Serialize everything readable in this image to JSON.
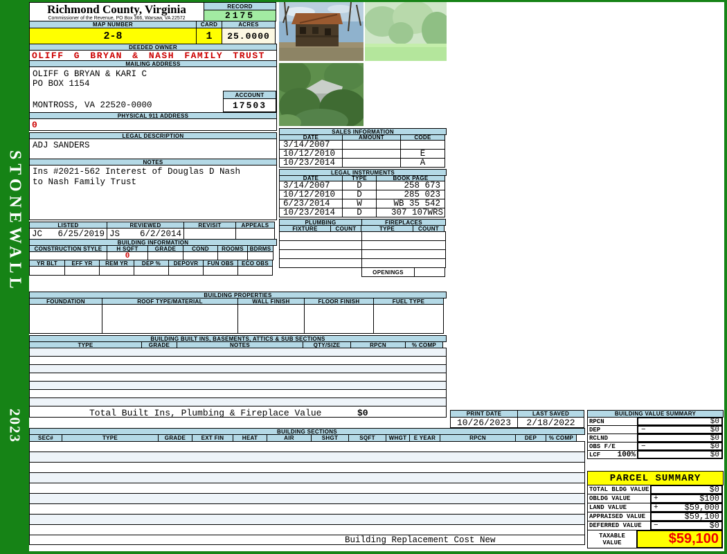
{
  "colors": {
    "green": "#168316",
    "band": "#b4d9e6",
    "yellow": "#ffff00",
    "record_green": "#a2eba2",
    "cream": "#fcf8e3",
    "red": "#cc0000"
  },
  "sidebar": {
    "district": "STONEWALL",
    "year": "2023"
  },
  "header": {
    "county": "Richmond County, Virginia",
    "subtitle": "Commissioner of the Revenue, PO Box 366, Warsaw, VA 22572",
    "record_label": "RECORD",
    "record_value": "2175",
    "map_label": "MAP NUMBER",
    "map_value": "2-8",
    "card_label": "CARD",
    "card_value": "1",
    "acres_label": "ACRES",
    "acres_value": "25.0000"
  },
  "owner": {
    "deeded_label": "DEEDED OWNER",
    "deeded_value": "OLIFF G BRYAN & NASH FAMILY TRUST",
    "mailing_label": "MAILING ADDRESS",
    "mailing_line1": "OLIFF G BRYAN & KARI C",
    "mailing_line2": "PO BOX 1154",
    "mailing_line3": "MONTROSS, VA 22520-0000",
    "account_label": "ACCOUNT",
    "account_value": "17503",
    "physical_label": "PHYSICAL 911 ADDRESS",
    "physical_value": "0"
  },
  "legal": {
    "label": "LEGAL DESCRIPTION",
    "value": "ADJ SANDERS",
    "notes_label": "NOTES",
    "notes_line1": "Ins #2021-562 Interest of Douglas D Nash",
    "notes_line2": "to Nash Family Trust"
  },
  "review": {
    "listed_label": "LISTED",
    "listed_by": "JC",
    "listed_date": "6/25/2019",
    "reviewed_label": "REVIEWED",
    "reviewed_by": "JS",
    "reviewed_date": "6/2/2014",
    "revisit_label": "REVISIT",
    "appeals_label": "APPEALS"
  },
  "building_info": {
    "title": "BUILDING INFORMATION",
    "headers1": [
      "CONSTRUCTION STYLE",
      "H SQFT",
      "GRADE",
      "COND",
      "ROOMS",
      "BDRMS"
    ],
    "h_sqft_value": "0",
    "headers2": [
      "YR BLT",
      "EFF YR",
      "REM YR",
      "DEP %",
      "DEPOVR",
      "FUN OBS",
      "ECO OBS"
    ]
  },
  "building_properties": {
    "title": "BUILDING PROPERTIES",
    "headers": [
      "FOUNDATION",
      "ROOF TYPE/MATERIAL",
      "WALL FINISH",
      "FLOOR FINISH",
      "FUEL TYPE"
    ]
  },
  "built_ins": {
    "title": "BUILDING BUILT INS, BASEMENTS, ATTICS & SUB SECTIONS",
    "headers": [
      "TYPE",
      "GRADE",
      "NOTES",
      "QTY/SIZE",
      "RPCN",
      "% COMP"
    ],
    "total_label": "Total Built Ins, Plumbing & Fireplace Value",
    "total_value": "$0"
  },
  "sales": {
    "title": "SALES INFORMATION",
    "headers": [
      "DATE",
      "AMOUNT",
      "CODE"
    ],
    "rows": [
      {
        "date": "3/14/2007",
        "amount": "",
        "code": ""
      },
      {
        "date": "10/12/2010",
        "amount": "",
        "code": "E"
      },
      {
        "date": "10/23/2014",
        "amount": "",
        "code": "A"
      }
    ]
  },
  "instruments": {
    "title": "LEGAL INSTRUMENTS",
    "headers": [
      "DATE",
      "TYPE",
      "BOOK PAGE"
    ],
    "rows": [
      {
        "date": "3/14/2007",
        "type": "D",
        "book_page": "258 673"
      },
      {
        "date": "10/12/2010",
        "type": "D",
        "book_page": "285 023"
      },
      {
        "date": "6/23/2014",
        "type": "W",
        "book_page": "WB 35 542"
      },
      {
        "date": "10/23/2014",
        "type": "D",
        "book_page": "307 107WRS"
      }
    ]
  },
  "plumbing": {
    "title": "PLUMBING",
    "headers": [
      "FIXTURE",
      "COUNT"
    ]
  },
  "fireplaces": {
    "title": "FIREPLACES",
    "headers": [
      "TYPE",
      "COUNT"
    ],
    "openings_label": "OPENINGS"
  },
  "dates": {
    "print_label": "PRINT DATE",
    "print_value": "10/26/2023",
    "saved_label": "LAST SAVED",
    "saved_value": "2/18/2022"
  },
  "building_value_summary": {
    "title": "BUILDING VALUE SUMMARY",
    "rows": [
      {
        "label": "RPCN",
        "pct": "",
        "sign": "",
        "value": "$0"
      },
      {
        "label": "DEP",
        "pct": "",
        "sign": "−",
        "value": "$0"
      },
      {
        "label": "RCLND",
        "pct": "",
        "sign": "",
        "value": "$0"
      },
      {
        "label": "OBS F/E",
        "pct": "",
        "sign": "−",
        "value": "$0"
      },
      {
        "label": "LCF",
        "pct": "100%",
        "sign": "",
        "value": "$0"
      }
    ]
  },
  "parcel_summary": {
    "title": "PARCEL SUMMARY",
    "rows": [
      {
        "label": "TOTAL BLDG VALUE",
        "sign": "",
        "value": "$0"
      },
      {
        "label": "OBLDG VALUE",
        "sign": "+",
        "value": "$100"
      },
      {
        "label": "LAND VALUE",
        "sign": "+",
        "value": "$59,000"
      },
      {
        "label": "APPRAISED VALUE",
        "sign": "",
        "value": "$59,100"
      },
      {
        "label": "DEFERRED VALUE",
        "sign": "−",
        "value": "$0"
      }
    ],
    "taxable_label": "TAXABLE VALUE",
    "taxable_value": "$59,100"
  },
  "building_sections": {
    "title": "BUILDING SECTIONS",
    "headers": [
      "SEC#",
      "TYPE",
      "GRADE",
      "EXT FIN",
      "HEAT",
      "AIR",
      "SHGT",
      "SQFT",
      "WHGT",
      "E YEAR",
      "RPCN",
      "DEP",
      "% COMP"
    ],
    "footer": "Building Replacement Cost New"
  }
}
